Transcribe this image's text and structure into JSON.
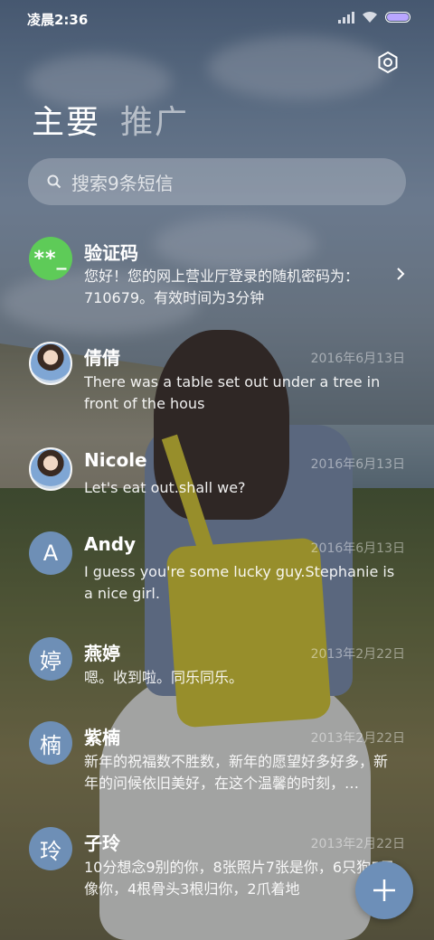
{
  "status_bar": {
    "time": "凌晨2:36"
  },
  "tabs": [
    {
      "label": "主要"
    },
    {
      "label": "推广"
    }
  ],
  "search": {
    "placeholder": "搜索9条短信"
  },
  "conversations": [
    {
      "name": "验证码",
      "avatar_text": "**_",
      "date": "",
      "message": "您好！您的网上营业厅登录的随机密码为：710679。有效时间为3分钟"
    },
    {
      "name": "倩倩",
      "avatar_text": "",
      "date": "2016年6月13日",
      "message": "There was a table set out under a tree in front of the hous"
    },
    {
      "name": "Nicole",
      "avatar_text": "",
      "date": "2016年6月13日",
      "message": "Let's eat out.shall we?"
    },
    {
      "name": "Andy",
      "avatar_text": "A",
      "date": "2016年6月13日",
      "message": "I guess you're some lucky guy.Stephanie is a nice girl."
    },
    {
      "name": "燕婷",
      "avatar_text": "婷",
      "date": "2013年2月22日",
      "message": "嗯。收到啦。同乐同乐。"
    },
    {
      "name": "紫楠",
      "avatar_text": "楠",
      "date": "2013年2月22日",
      "message": "新年的祝福数不胜数，新年的愿望好多好多，新年的问候依旧美好，在这个温馨的时刻，…"
    },
    {
      "name": "子玲",
      "avatar_text": "玲",
      "date": "2013年2月22日",
      "message": "10分想念9别的你，8张照片7张是你，6只狗5只像你，4根骨头3根归你，2爪着地"
    }
  ],
  "colors": {
    "accent": "#6d8fb8",
    "verify_avatar": "#5ecb58"
  },
  "icons": {
    "settings": "gear-icon",
    "search": "search-icon",
    "compose": "plus-icon"
  }
}
